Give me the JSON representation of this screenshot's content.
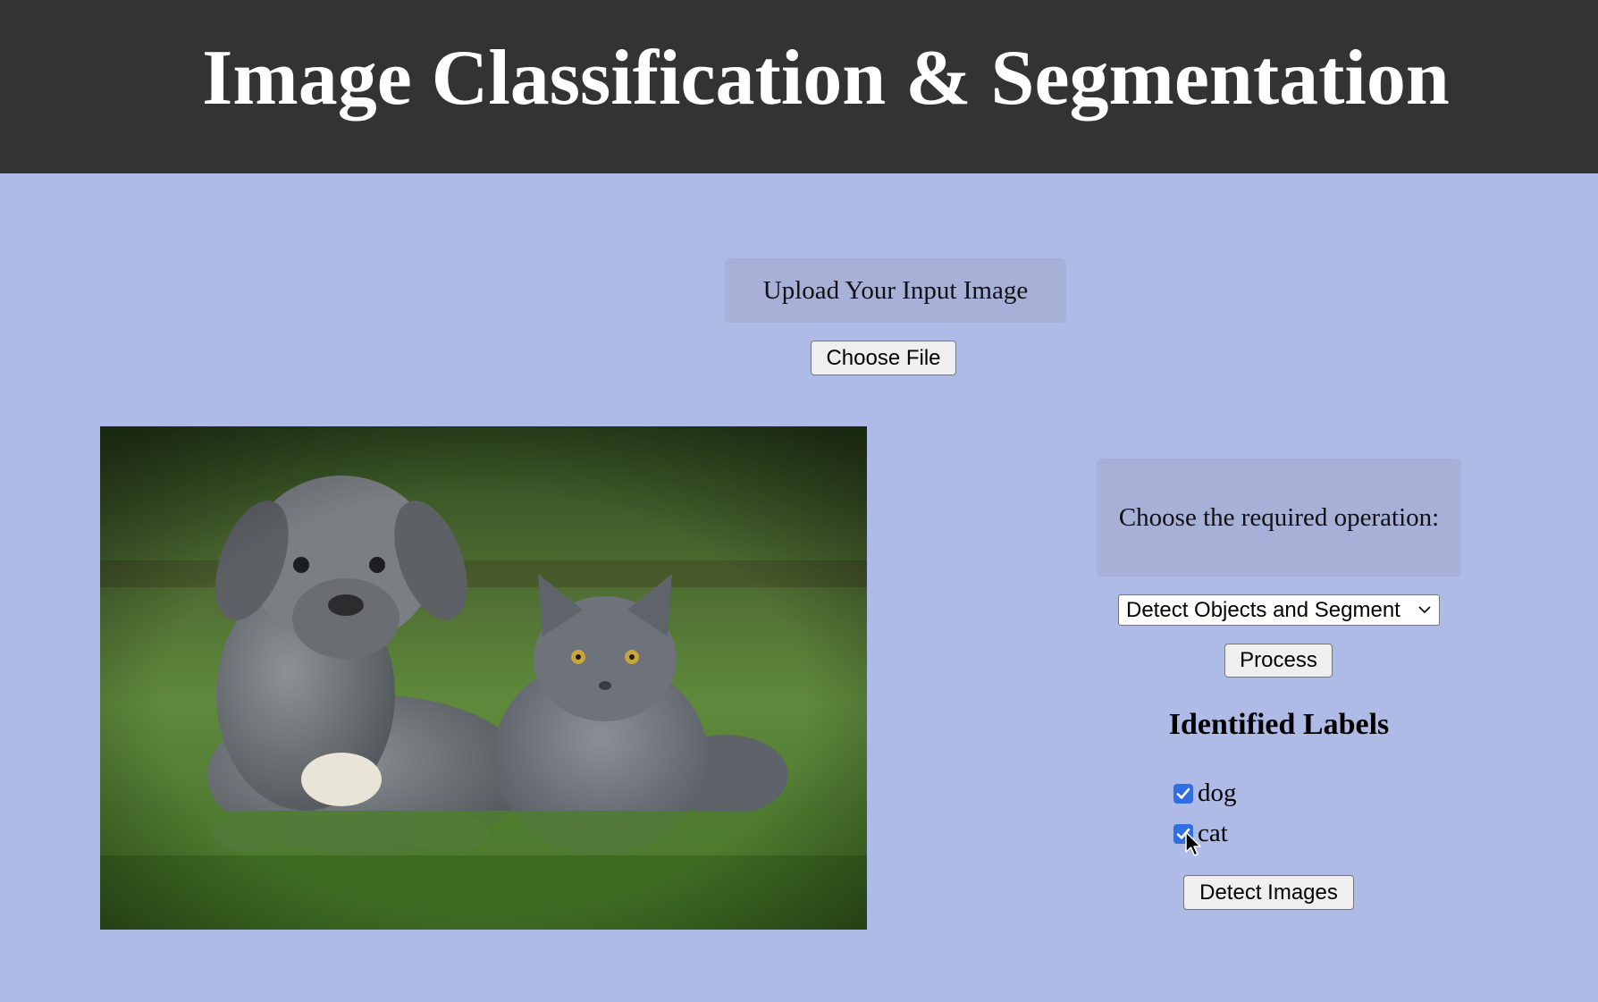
{
  "header": {
    "title": "Image Classification & Segmentation"
  },
  "upload": {
    "label": "Upload Your Input Image",
    "choose_file_label": "Choose File"
  },
  "operation": {
    "prompt": "Choose the required operation:",
    "selected": "Detect Objects and Segment",
    "process_label": "Process"
  },
  "labels_section": {
    "title": "Identified Labels",
    "items": [
      {
        "label": "dog",
        "checked": true
      },
      {
        "label": "cat",
        "checked": true
      }
    ],
    "detect_label": "Detect Images"
  },
  "colors": {
    "header_bg": "#333333",
    "page_bg": "#afbbe7",
    "panel_bg": "#a7b1d8",
    "checkbox": "#2f6fe3"
  }
}
